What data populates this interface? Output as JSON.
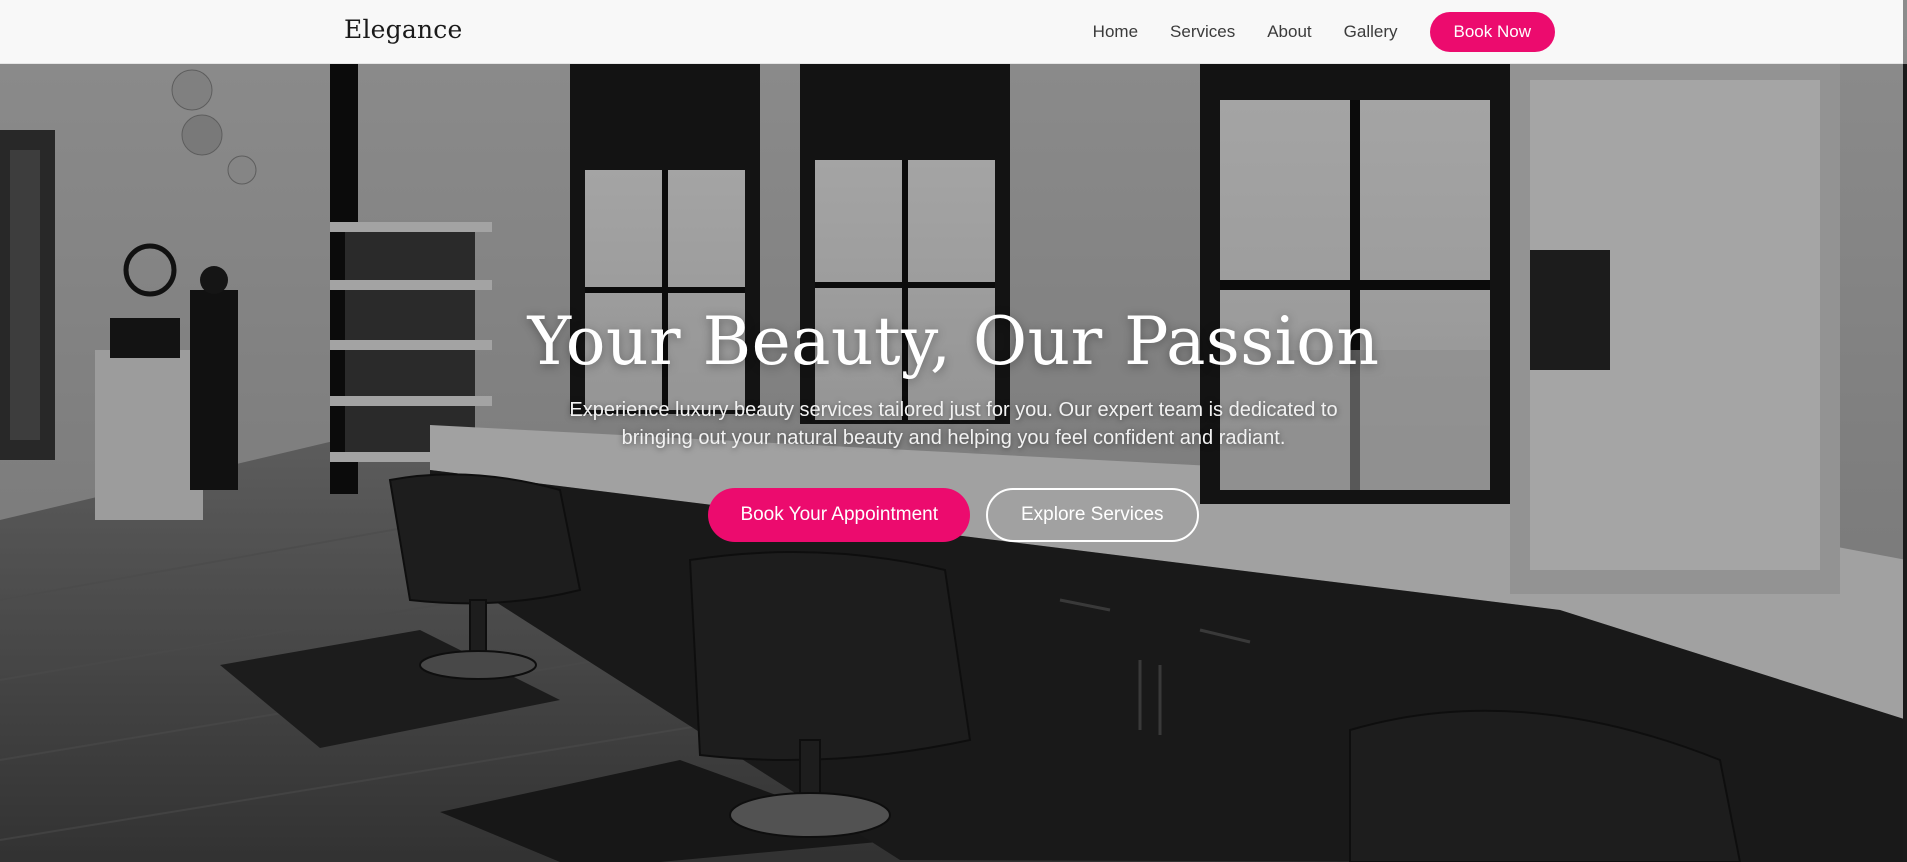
{
  "nav": {
    "logo": "Elegance",
    "links": [
      "Home",
      "Services",
      "About",
      "Gallery"
    ],
    "cta": "Book Now"
  },
  "hero": {
    "title": "Your Beauty, Our Passion",
    "subtitle": "Experience luxury beauty services tailored just for you. Our expert team is dedicated to bringing out your natural beauty and helping you feel confident and radiant.",
    "primary_button": "Book Your Appointment",
    "secondary_button": "Explore Services",
    "background_image": "salon-interior-photo"
  },
  "colors": {
    "accent": "#ec0b6e",
    "navbar_bg": "#f8f8f8",
    "nav_text": "#3b3b3b",
    "hero_text": "#ffffff"
  }
}
